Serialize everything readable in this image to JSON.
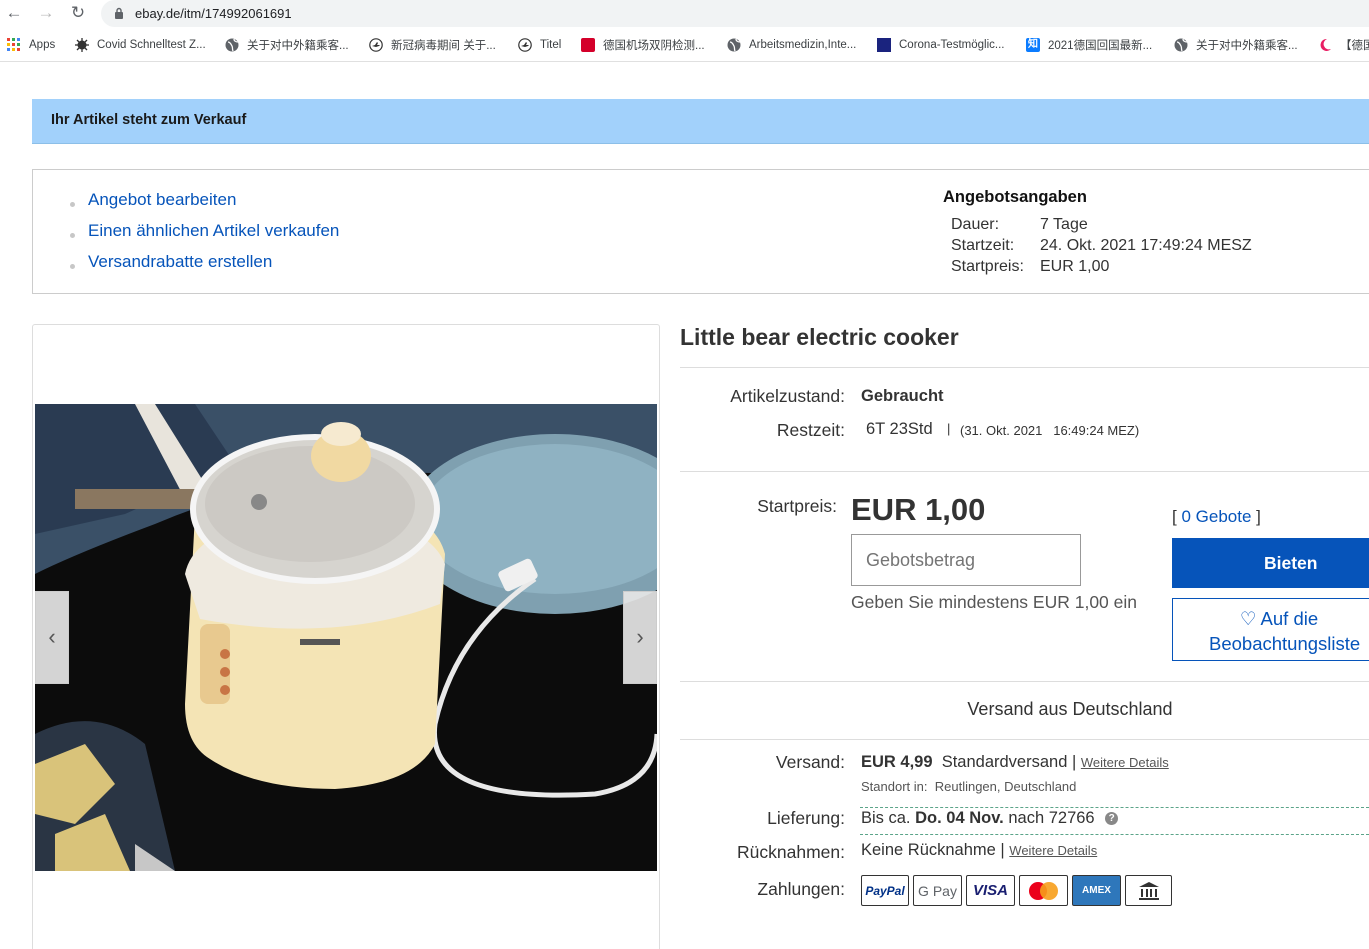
{
  "browser": {
    "url": "ebay.de/itm/174992061691",
    "bookmarks": [
      {
        "label": "Apps",
        "icon": "apps-grid-icon"
      },
      {
        "label": "Covid Schnelltest Z...",
        "icon": "virus-icon"
      },
      {
        "label": "关于对中外籍乘客...",
        "icon": "globe-icon"
      },
      {
        "label": "新冠病毒期间 关于...",
        "icon": "airline-icon"
      },
      {
        "label": "Titel",
        "icon": "airline-icon"
      },
      {
        "label": "德国机场双阴检测...",
        "icon": "news-icon"
      },
      {
        "label": "Arbeitsmedizin,Inte...",
        "icon": "globe-icon"
      },
      {
        "label": "Corona-Testmöglic...",
        "icon": "flag-icon"
      },
      {
        "label": "2021德国回国最新...",
        "icon": "zhihu-icon"
      },
      {
        "label": "关于对中外籍乘客...",
        "icon": "globe-icon"
      },
      {
        "label": "【德国",
        "icon": "moon-icon"
      }
    ]
  },
  "banner": {
    "text": "Ihr Artikel steht zum Verkauf"
  },
  "actions": [
    "Angebot bearbeiten",
    "Einen ähnlichen Artikel verkaufen",
    "Versandrabatte erstellen"
  ],
  "offer_info": {
    "heading": "Angebotsangaben",
    "rows": [
      {
        "label": "Dauer:",
        "value": "7 Tage"
      },
      {
        "label": "Startzeit:",
        "value": "24. Okt. 2021 17:49:24 MESZ"
      },
      {
        "label": "Startpreis:",
        "value": "EUR 1,00"
      }
    ]
  },
  "gallery": {
    "prev_icon": "chevron-left-icon",
    "next_icon": "chevron-right-icon"
  },
  "item": {
    "title": "Little bear electric cooker",
    "condition_label": "Artikelzustand:",
    "condition_value": "Gebraucht",
    "time_label": "Restzeit:",
    "time_value": "6T 23Std",
    "time_end": "(31. Okt. 2021   16:49:24 MEZ)",
    "price_label": "Startpreis:",
    "price": "EUR 1,00",
    "bids_prefix": "[",
    "bids_link": "0 Gebote",
    "bids_suffix": "]",
    "bid_placeholder": "Gebotsbetrag",
    "bid_hint": "Geben Sie mindestens EUR 1,00 ein",
    "bid_button": "Bieten",
    "watch_button": "♡ Auf die Beobachtungsliste",
    "ship_from": "Versand aus Deutschland",
    "shipping_label": "Versand:",
    "shipping_price": "EUR 4,99",
    "shipping_type": "Standardversand |",
    "shipping_details": "Weitere Details",
    "location_label": "Standort in:",
    "location_value": "Reutlingen, Deutschland",
    "delivery_label": "Lieferung:",
    "delivery_prefix": "Bis ca.",
    "delivery_date": "Do. 04 Nov.",
    "delivery_suffix": "nach 72766",
    "returns_label": "Rücknahmen:",
    "returns_value": "Keine Rücknahme |",
    "returns_details": "Weitere Details",
    "payments_label": "Zahlungen:",
    "payment_methods": [
      "PayPal",
      "G Pay",
      "VISA",
      "Mastercard",
      "AMEX",
      "Bank"
    ]
  },
  "colors": {
    "link": "#0654ba",
    "banner": "#a2d1fb",
    "bid_button": "#0654ba"
  }
}
